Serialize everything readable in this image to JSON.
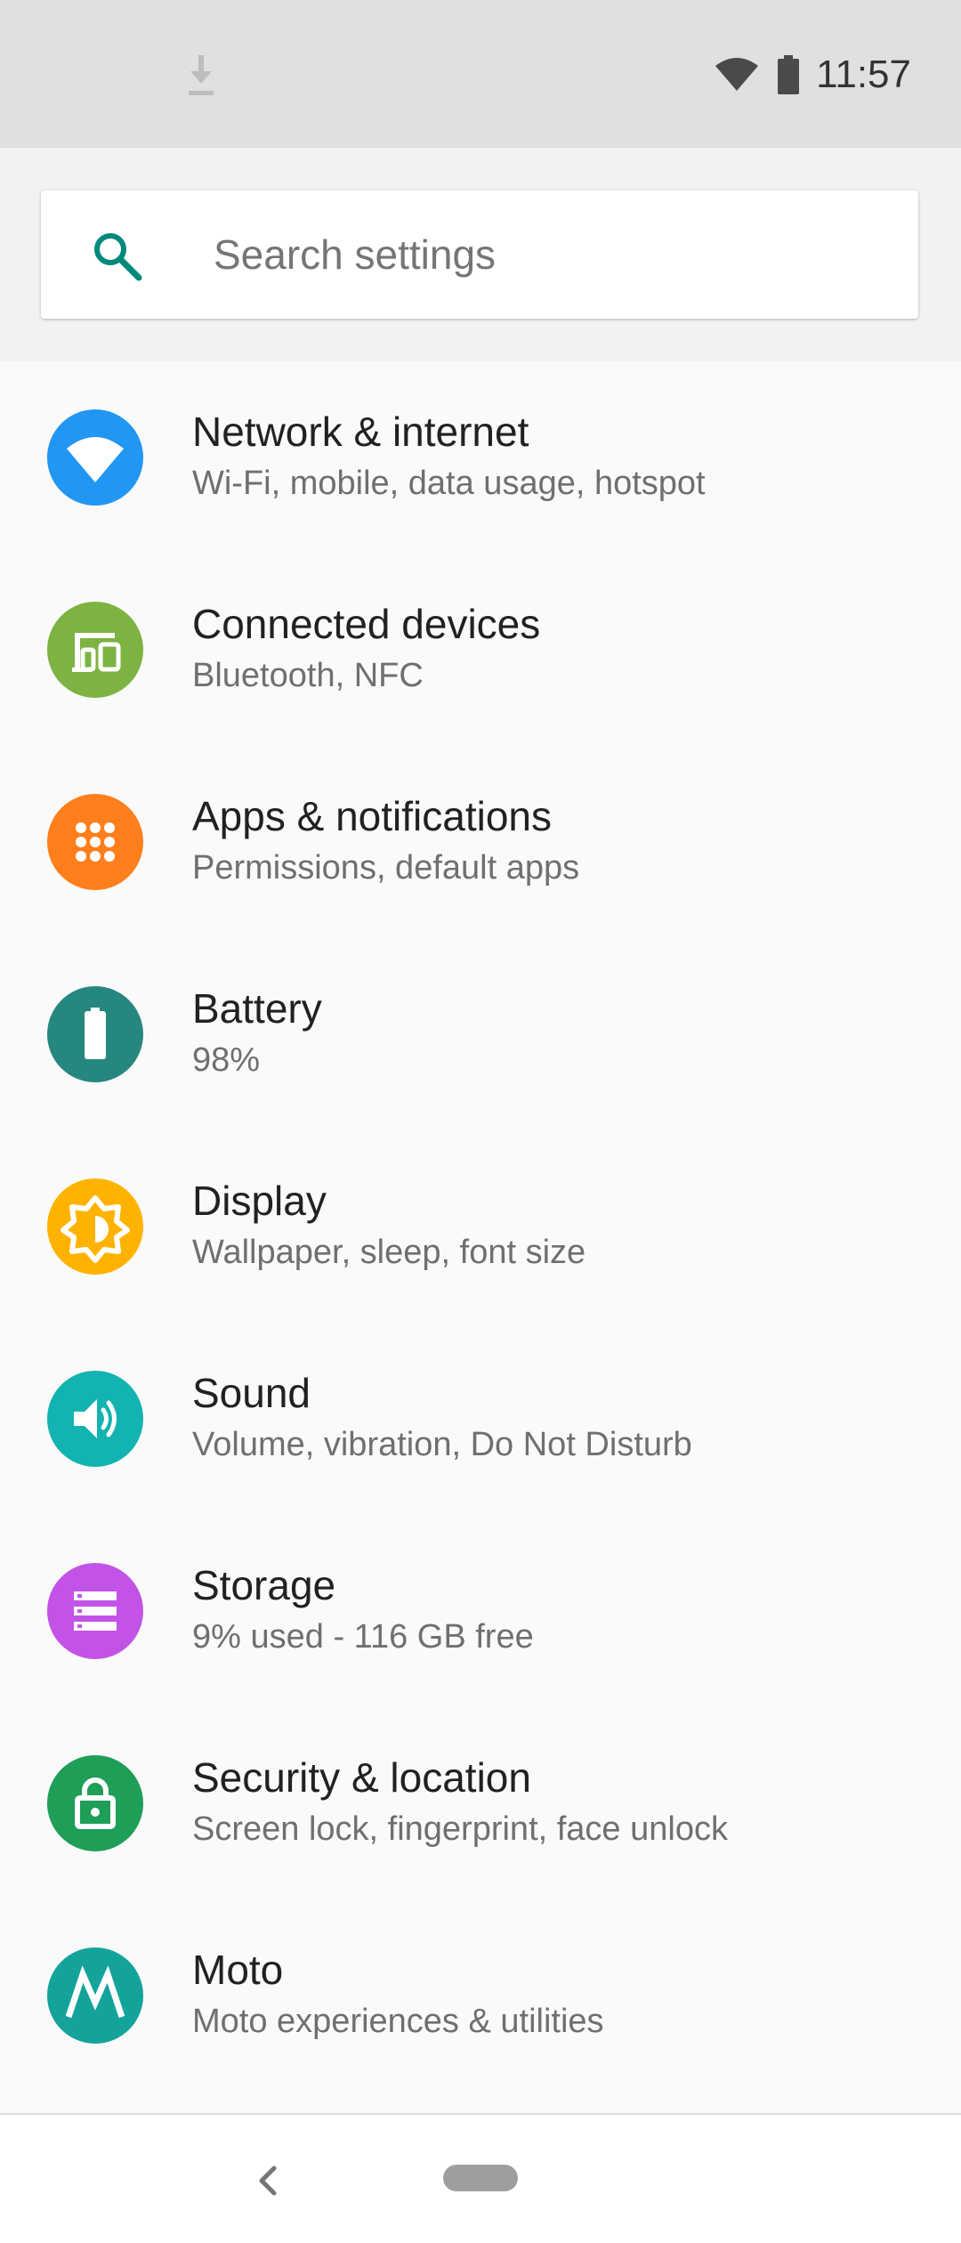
{
  "status_bar": {
    "time": "11:57",
    "icons": [
      "download-icon",
      "wifi-icon",
      "battery-icon"
    ]
  },
  "search": {
    "placeholder": "Search settings",
    "value": ""
  },
  "items": [
    {
      "title": "Network & internet",
      "subtitle": "Wi-Fi, mobile, data usage, hotspot",
      "icon": "wifi-icon",
      "color": "#2196f3"
    },
    {
      "title": "Connected devices",
      "subtitle": "Bluetooth, NFC",
      "icon": "devices-icon",
      "color": "#7cb342"
    },
    {
      "title": "Apps & notifications",
      "subtitle": "Permissions, default apps",
      "icon": "apps-icon",
      "color": "#ff7f1c"
    },
    {
      "title": "Battery",
      "subtitle": "98%",
      "icon": "battery-icon",
      "color": "#26877f"
    },
    {
      "title": "Display",
      "subtitle": "Wallpaper, sleep, font size",
      "icon": "brightness-icon",
      "color": "#ffb300"
    },
    {
      "title": "Sound",
      "subtitle": "Volume, vibration, Do Not Disturb",
      "icon": "volume-icon",
      "color": "#12b3b0"
    },
    {
      "title": "Storage",
      "subtitle": "9% used - 116 GB free",
      "icon": "storage-icon",
      "color": "#c353e6"
    },
    {
      "title": "Security & location",
      "subtitle": "Screen lock, fingerprint, face unlock",
      "icon": "lock-icon",
      "color": "#1e9e57"
    },
    {
      "title": "Moto",
      "subtitle": "Moto experiences & utilities",
      "icon": "moto-icon",
      "color": "#14a39a"
    }
  ],
  "nav": {
    "icons": [
      "back-icon",
      "home-pill-icon"
    ]
  }
}
